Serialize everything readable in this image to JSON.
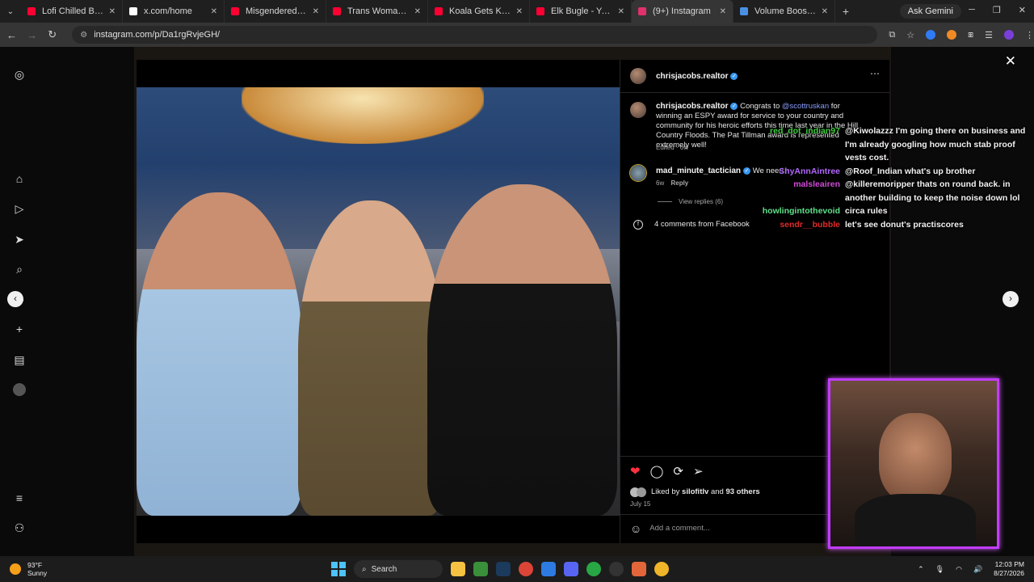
{
  "tabs": [
    {
      "title": "Lofi Chilled Beats",
      "color": "#ff0033"
    },
    {
      "title": "x.com/home",
      "color": "#ffffff"
    },
    {
      "title": "Misgendered Shoplifte",
      "color": "#ff0033"
    },
    {
      "title": "Trans Woman Keep",
      "color": "#ff0033"
    },
    {
      "title": "Koala Gets Kicked Out",
      "color": "#ff0033"
    },
    {
      "title": "Elk Bugle - YouTube",
      "color": "#ff0033"
    },
    {
      "title": "(9+) Instagram",
      "color": "#e1306c",
      "active": true
    },
    {
      "title": "Volume Booster -",
      "color": "#4a90e2"
    }
  ],
  "browser": {
    "ask_gemini": "Ask Gemini",
    "url": "instagram.com/p/Da1rgRvjeGH/"
  },
  "post": {
    "author": "chrisjacobs.realtor",
    "caption_author": "chrisjacobs.realtor",
    "caption_prefix": "Congrats to",
    "caption_mention": "@scottruskan",
    "caption_rest": "for winning an ESPY award for service to your country and community for his heroic efforts this time last year in the Hill Country Floods. The Pat Tillman award is represented extremely well!",
    "caption_meta": "Edited · 6w",
    "comment_author": "mad_minute_tactician",
    "comment_text": "We need h",
    "comment_age": "6w",
    "comment_reply": "Reply",
    "view_replies": "View replies (6)",
    "facebook_comments": "4 comments from Facebook",
    "liked_by_prefix": "Liked by",
    "liked_by_user": "silofitlv",
    "liked_by_and": "and",
    "liked_by_others": "93 others",
    "date": "July 15",
    "add_comment_placeholder": "Add a comment..."
  },
  "chat": [
    {
      "user": "red_dot_indian97",
      "color": "#3fd13f",
      "message": "@Kiwolazzz I'm going there on business and I'm already googling how much stab proof vests cost."
    },
    {
      "user": "ShyAnnAintree",
      "color": "#b368ff",
      "message": "@Roof_Indian what's up brother"
    },
    {
      "user": "malsleairen",
      "color": "#d04bd6",
      "message": "@killeremoripper thats on round back. in another building to keep the noise down lol"
    },
    {
      "user": "howlingintothevoid",
      "color": "#5fe08a",
      "message": "circa rules"
    },
    {
      "user": "sendr__bubble",
      "color": "#e02a2a",
      "message": "let's see donut's practiscores"
    }
  ],
  "taskbar": {
    "temp": "93°F",
    "condition": "Sunny",
    "search": "Search",
    "time": "12:03 PM",
    "date": "8/27/2026"
  },
  "colors": {
    "accent_like": "#ff3040",
    "webcam_border": "#c23cff"
  }
}
